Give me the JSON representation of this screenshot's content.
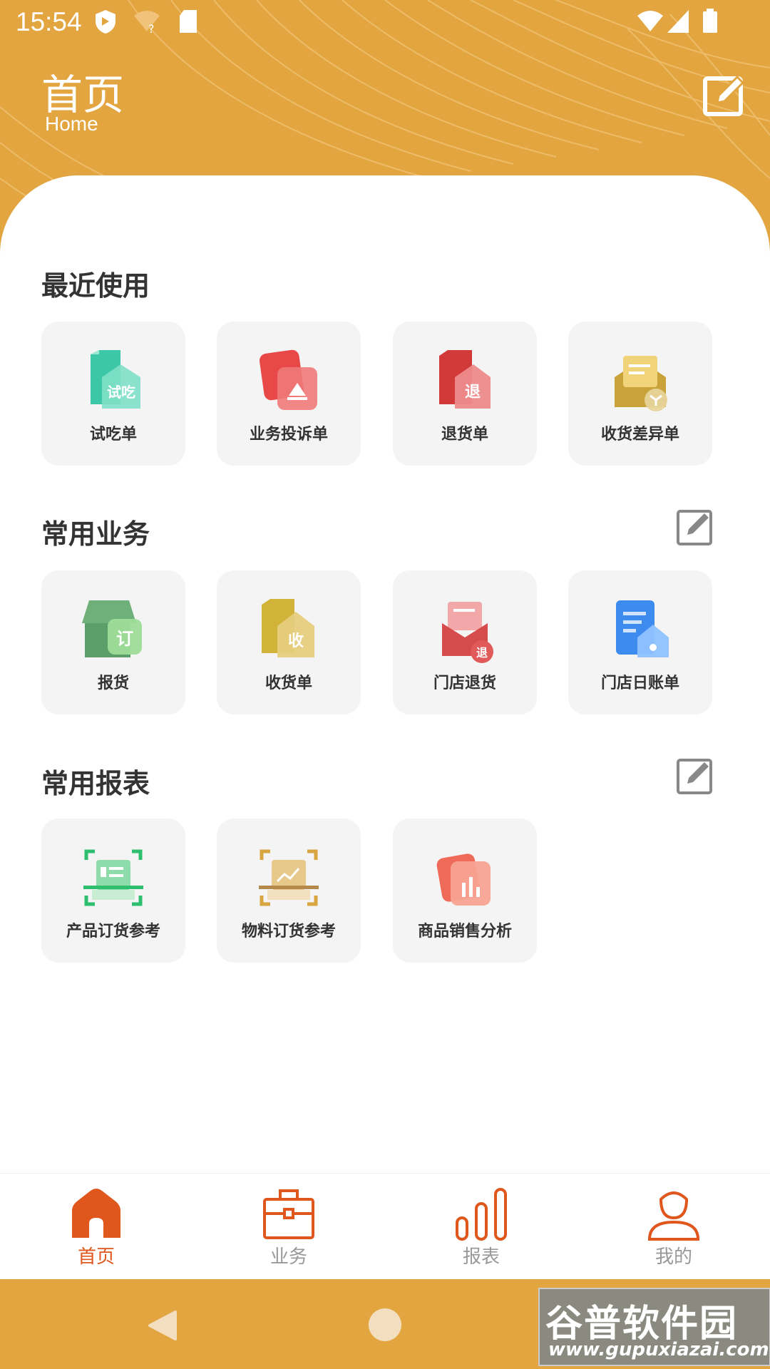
{
  "status_bar": {
    "time": "15:54"
  },
  "header": {
    "title": "首页",
    "subtitle": "Home"
  },
  "sections": {
    "recent": {
      "title": "最近使用",
      "items": [
        {
          "label": "试吃单",
          "icon": "tasting-order-icon",
          "badge": "试吃"
        },
        {
          "label": "业务投诉单",
          "icon": "complaint-order-icon"
        },
        {
          "label": "退货单",
          "icon": "return-order-icon",
          "badge": "退"
        },
        {
          "label": "收货差异单",
          "icon": "receipt-difference-icon"
        }
      ]
    },
    "business": {
      "title": "常用业务",
      "items": [
        {
          "label": "报货",
          "icon": "order-goods-icon",
          "badge": "订"
        },
        {
          "label": "收货单",
          "icon": "receipt-order-icon",
          "badge": "收"
        },
        {
          "label": "门店退货",
          "icon": "store-return-icon",
          "badge": "退"
        },
        {
          "label": "门店日账单",
          "icon": "store-daily-bill-icon"
        }
      ]
    },
    "reports": {
      "title": "常用报表",
      "items": [
        {
          "label": "产品订货参考",
          "icon": "product-order-reference-icon"
        },
        {
          "label": "物料订货参考",
          "icon": "material-order-reference-icon"
        },
        {
          "label": "商品销售分析",
          "icon": "sales-analysis-icon"
        }
      ]
    }
  },
  "tabs": [
    {
      "label": "首页",
      "icon": "home-icon",
      "active": true
    },
    {
      "label": "业务",
      "icon": "briefcase-icon",
      "active": false
    },
    {
      "label": "报表",
      "icon": "bar-chart-icon",
      "active": false
    },
    {
      "label": "我的",
      "icon": "person-icon",
      "active": false
    }
  ],
  "watermark": {
    "title": "谷普软件园",
    "url": "www.gupuxiazai.com"
  },
  "colors": {
    "brand": "#E3A540",
    "active_tab": "#E0571E",
    "tile_bg": "#F4F4F4"
  }
}
